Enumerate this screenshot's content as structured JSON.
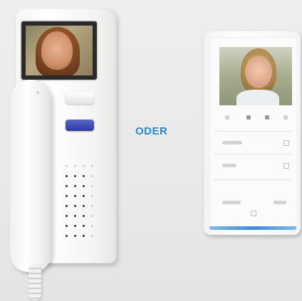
{
  "label": {
    "text": "ODER",
    "color": "#1e8cd0"
  },
  "colors": {
    "handset_button_blue": "#2f3aa0",
    "monitor_accent": "#3b8fd6"
  }
}
